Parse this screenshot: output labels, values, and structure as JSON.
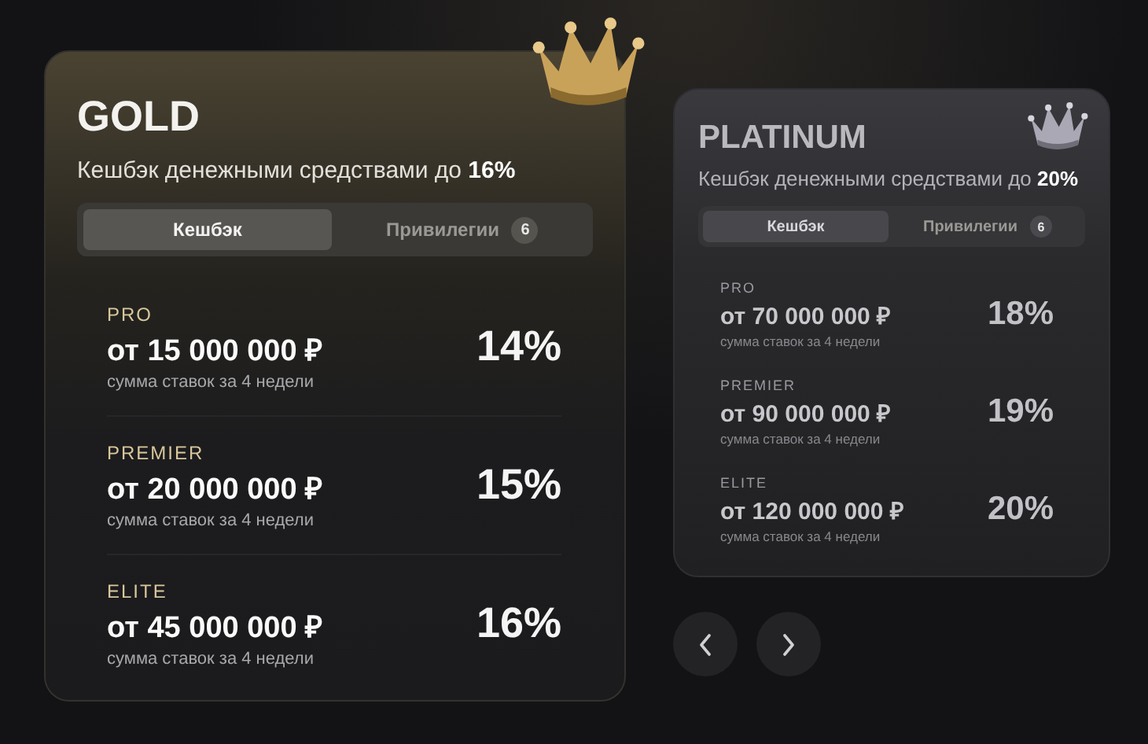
{
  "cards": [
    {
      "kind": "gold",
      "title": "GOLD",
      "subtitle": "Кешбэк денежными средствами до **16%**",
      "tabs": [
        {
          "label": "Кешбэк",
          "selected": true
        },
        {
          "label": "Привилегии",
          "badge": "6",
          "selected": false
        }
      ],
      "tiers": [
        {
          "name": "PRO",
          "amount": "от 15 000 000 ₽",
          "note": "сумма ставок за 4 недели",
          "percent": "14%"
        },
        {
          "name": "PREMIER",
          "amount": "от 20 000 000 ₽",
          "note": "сумма ставок за 4 недели",
          "percent": "15%"
        },
        {
          "name": "ELITE",
          "amount": "от 45 000 000 ₽",
          "note": "сумма ставок за 4 недели",
          "percent": "16%"
        }
      ]
    },
    {
      "kind": "platinum",
      "title": "PLATINUM",
      "subtitle": "Кешбэк денежными средствами до **20%**",
      "tabs": [
        {
          "label": "Кешбэк",
          "selected": true
        },
        {
          "label": "Привилегии",
          "badge": "6",
          "selected": false
        }
      ],
      "tiers": [
        {
          "name": "PRO",
          "amount": "от 70 000 000 ₽",
          "note": "сумма ставок за 4 недели",
          "percent": "18%"
        },
        {
          "name": "PREMIER",
          "amount": "от 90 000 000 ₽",
          "note": "сумма ставок за 4 недели",
          "percent": "19%"
        },
        {
          "name": "ELITE",
          "amount": "от 120 000 000 ₽",
          "note": "сумма ставок за 4 недели",
          "percent": "20%"
        }
      ]
    }
  ],
  "nav": [
    {
      "kind": "prev"
    },
    {
      "kind": "next"
    }
  ]
}
